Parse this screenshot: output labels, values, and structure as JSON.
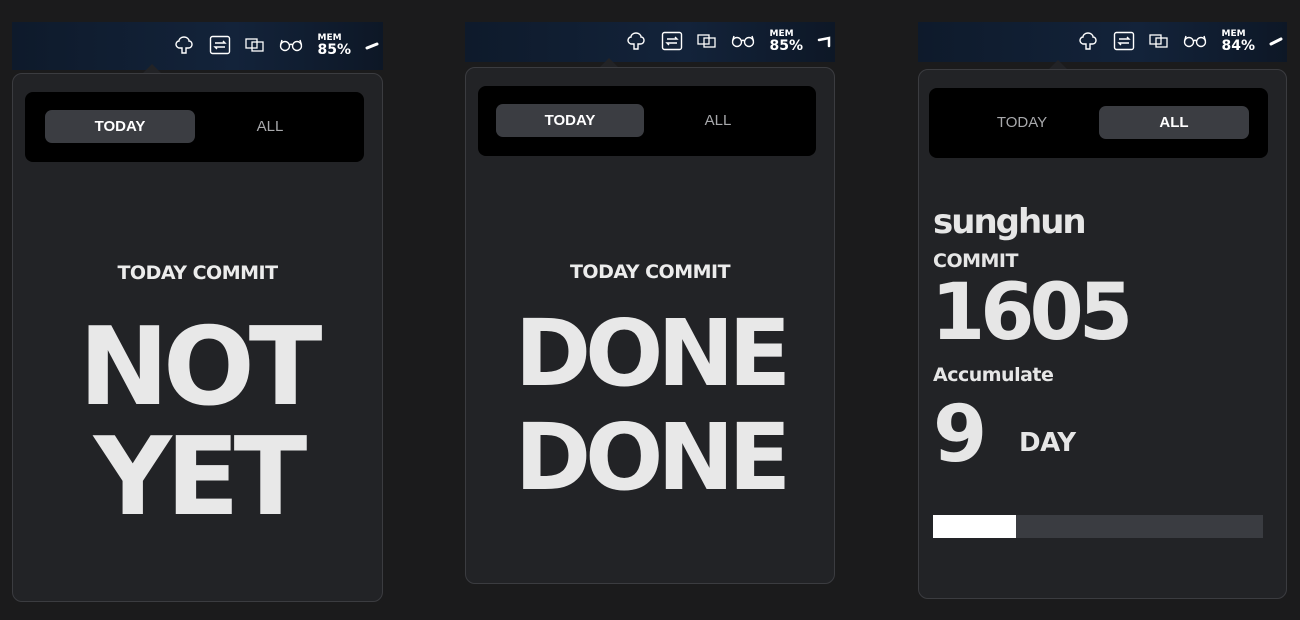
{
  "menubar": {
    "mem_label": "MEM",
    "icons": [
      "tree-icon",
      "window-switch-icon",
      "copy-icon",
      "glasses-icon"
    ]
  },
  "panels": [
    {
      "mem_value": "85%",
      "tabs": [
        {
          "label": "TODAY",
          "active": true
        },
        {
          "label": "ALL",
          "active": false
        }
      ],
      "heading": "TODAY COMMIT",
      "status_line1": "NOT",
      "status_line2": "YET"
    },
    {
      "mem_value": "85%",
      "tabs": [
        {
          "label": "TODAY",
          "active": true
        },
        {
          "label": "ALL",
          "active": false
        }
      ],
      "heading": "TODAY COMMIT",
      "status_line1": "DONE",
      "status_line2": "DONE"
    },
    {
      "mem_value": "84%",
      "tabs": [
        {
          "label": "TODAY",
          "active": false
        },
        {
          "label": "ALL",
          "active": true
        }
      ],
      "username": "sunghun",
      "commit_label": "COMMIT",
      "commit_count": "1605",
      "accumulate_label": "Accumulate",
      "day_count": "9",
      "day_label": "DAY",
      "progress": 0.25
    }
  ],
  "colors": {
    "background": "#1b1b1c",
    "card": "#222326",
    "segment": "#000000",
    "active_tab": "#3b3d42",
    "text": "#e8e8e8"
  }
}
